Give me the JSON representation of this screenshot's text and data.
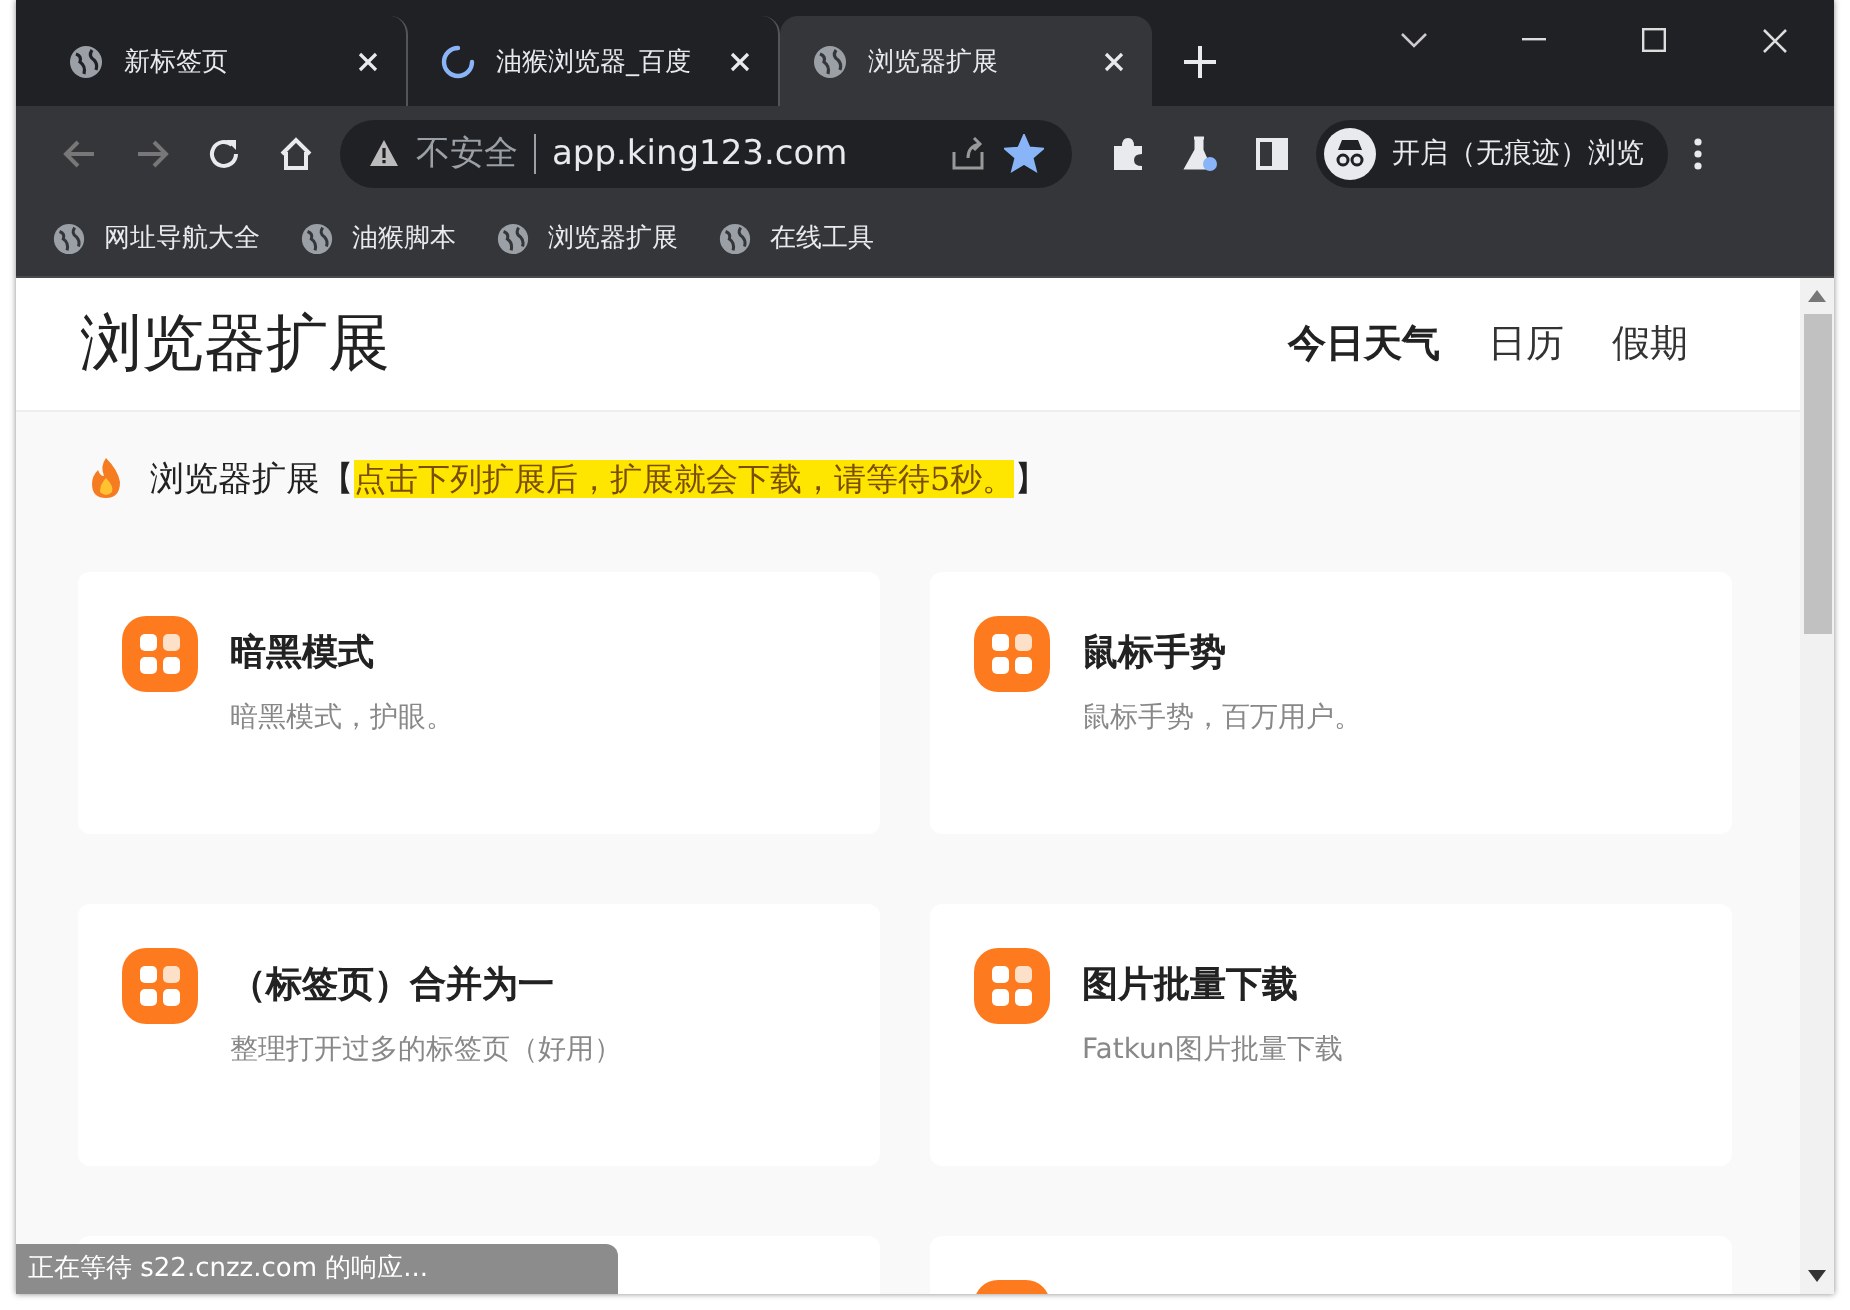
{
  "tabs": [
    {
      "title": "新标签页",
      "selected": false,
      "loading": false
    },
    {
      "title": "油猴浏览器_百度",
      "selected": false,
      "loading": true
    },
    {
      "title": "浏览器扩展",
      "selected": true,
      "loading": false
    }
  ],
  "address_bar": {
    "security": "不安全",
    "url": "app.king123.com",
    "bookmarked": true
  },
  "profile": {
    "label": "开启（无痕迹）浏览"
  },
  "bookmarks": [
    "网址导航大全",
    "油猴脚本",
    "浏览器扩展",
    "在线工具"
  ],
  "page": {
    "title": "浏览器扩展",
    "nav": [
      {
        "label": "今日天气",
        "selected": true
      },
      {
        "label": "日历",
        "selected": false
      },
      {
        "label": "假期",
        "selected": false
      }
    ],
    "notice": {
      "label": "浏览器扩展【",
      "highlight": "点击下列扩展后，扩展就会下载，请等待5秒。",
      "end": "】"
    },
    "cards": [
      {
        "title": "暗黑模式",
        "desc": "暗黑模式，护眼。"
      },
      {
        "title": "鼠标手势",
        "desc": "鼠标手势，百万用户。"
      },
      {
        "title": "（标签页）合并为一",
        "desc": "整理打开过多的标签页（好用）"
      },
      {
        "title": "图片批量下载",
        "desc": "Fatkun图片批量下载"
      }
    ]
  },
  "status_bar": "正在等待 s22.cnzz.com 的响应..."
}
